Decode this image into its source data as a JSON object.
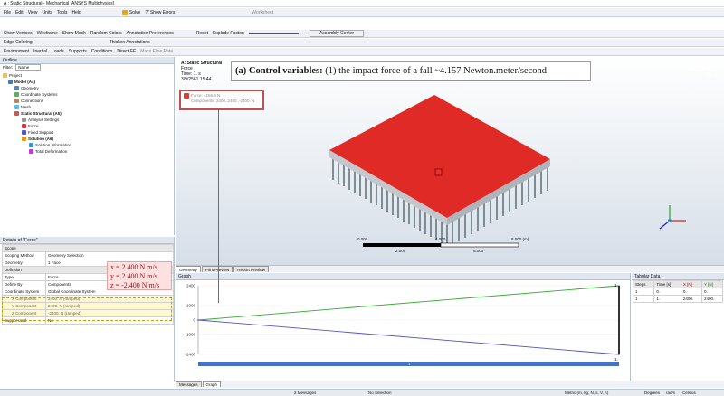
{
  "window": {
    "title": "A : Static Structural - Mechanical [ANSYS Multiphysics]"
  },
  "menu": [
    "File",
    "Edit",
    "View",
    "Units",
    "Tools",
    "Help"
  ],
  "toolbar1": {
    "solve": "Solve",
    "show_errors": "?/ Show Errors",
    "worksheet": "Worksheet"
  },
  "toolbar2": {
    "show_vertices": "Show Vertices",
    "wireframe": "Wireframe",
    "show_mesh": "Show Mesh",
    "random_colors": "Random Colors",
    "annotation_prefs": "Annotation Preferences",
    "reset": "Reset",
    "explode_factor": "Explode Factor:",
    "assembly_center": "Assembly Center"
  },
  "toolbar3": {
    "edge_coloring": "Edge Coloring",
    "thicken": "Thicken Annotations"
  },
  "context_bar": {
    "environment": "Environment",
    "inertial": "Inertial",
    "loads": "Loads",
    "supports": "Supports",
    "conditions": "Conditions",
    "direct_fe": "Direct FE",
    "mass_flow": "Mass Flow Rate"
  },
  "outline": {
    "title": "Outline",
    "filter_label": "Filter:",
    "filter_value": "Name",
    "items": [
      "Project",
      "Model (A4)",
      "Geometry",
      "Coordinate Systems",
      "Connections",
      "Mesh",
      "Static Structural (A5)",
      "Analysis Settings",
      "Force",
      "Fixed Support",
      "Solution (A6)",
      "Solution Information",
      "Total Deformation"
    ]
  },
  "details": {
    "title": "Details of \"Force\"",
    "sec_scope": "Scope",
    "sec_definition": "Definition",
    "rows": [
      {
        "k": "Scoping Method",
        "v": "Geometry Selection"
      },
      {
        "k": "Geometry",
        "v": "1 Face"
      },
      {
        "k": "Type",
        "v": "Force"
      },
      {
        "k": "Define By",
        "v": "Components"
      },
      {
        "k": "Coordinate System",
        "v": "Global Coordinate System"
      },
      {
        "k": "X Component",
        "v": "2400. N (ramped)"
      },
      {
        "k": "Y Component",
        "v": "2400. N (ramped)"
      },
      {
        "k": "Z Component",
        "v": "-2400. N (ramped)"
      },
      {
        "k": "Suppressed",
        "v": "No"
      }
    ]
  },
  "annotation_values": {
    "x": "x = 2.400 N.m/s",
    "y": "y = 2.400 N.m/s",
    "z": "z = -2.400 N.m/s"
  },
  "viewport": {
    "header_title": "A: Static Structural",
    "header_sub1": "Force",
    "header_sub2": "Time: 1. s",
    "header_sub3": "3/9/2561 15:44",
    "callout_bold": "(a) Control variables:",
    "callout_text": " (1) the impact force of a fall ~4.157 Newton.meter/second",
    "legend_force": "Force: 4156.9 N",
    "legend_components": "Components: 2400.,2400.,-2400. N",
    "brand": "ANSYS",
    "brand_version": "16.0",
    "scale_labels_top": [
      "0.000",
      "4.000",
      "8.000 (m)"
    ],
    "scale_labels_bottom": [
      "2.000",
      "6.000"
    ]
  },
  "view_tabs": [
    "Geometry",
    "Print Preview",
    "Report Preview"
  ],
  "graph": {
    "title": "Graph",
    "yticks": [
      "2400",
      "1000",
      "0",
      "-1000",
      "-2400"
    ],
    "end_label_top": "1.",
    "end_label_bottom": "1.",
    "timeline_label": "1"
  },
  "bottom_tabs": [
    "Messages",
    "Graph"
  ],
  "tabular": {
    "title": "Tabular Data",
    "headers": [
      "Steps",
      "Time [s]",
      "X [N]",
      "Y [N]"
    ],
    "rows": [
      [
        "1",
        "0.",
        "0.",
        "0."
      ],
      [
        "1",
        "1.",
        "2400.",
        "2400."
      ]
    ]
  },
  "status": {
    "messages": "2 Messages",
    "selection": "No Selection",
    "units": "Metric (m, kg, N, s, V, A)",
    "degrees": "Degrees",
    "rads": "rad/s",
    "celsius": "Celsius"
  },
  "chart_data": {
    "type": "line",
    "x": [
      0,
      1
    ],
    "series": [
      {
        "values": [
          0,
          2400
        ]
      },
      {
        "values": [
          0,
          -2400
        ]
      }
    ],
    "ylim": [
      -2400,
      2400
    ]
  }
}
